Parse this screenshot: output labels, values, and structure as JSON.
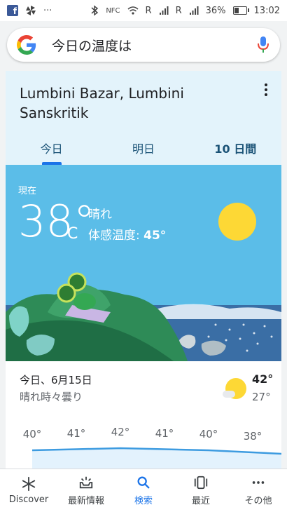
{
  "status_bar": {
    "icons_left": [
      "facebook-icon",
      "pinwheel-icon",
      "more-icon"
    ],
    "more_dots": "···",
    "icons_right": [
      "bluetooth-icon",
      "nfc-icon",
      "wifi-icon",
      "signal-icon",
      "signal-icon"
    ],
    "nfc": "NFC",
    "roaming1": "R",
    "roaming2": "R",
    "battery_pct": "36%",
    "battery_level": 0.36,
    "time": "13:02"
  },
  "search": {
    "query": "今日の温度は"
  },
  "weather": {
    "location": "Lumbini Bazar, Lumbini Sanskritik",
    "tabs": [
      {
        "label": "今日"
      },
      {
        "label": "明日"
      },
      {
        "label": "10 日間"
      }
    ],
    "now_label": "現在",
    "temperature": "38°",
    "unit": "C",
    "condition": "晴れ",
    "feels_like_label": "体感温度: ",
    "feels_like_value": "45°",
    "forecast": {
      "date": "今日、6月15日",
      "description": "晴れ時々曇り",
      "high": "42°",
      "low": "27°",
      "hourly": [
        "40°",
        "41°",
        "42°",
        "41°",
        "40°",
        "38°"
      ]
    }
  },
  "bottom_nav": [
    {
      "label": "Discover",
      "icon": "asterisk-icon"
    },
    {
      "label": "最新情報",
      "icon": "updates-icon"
    },
    {
      "label": "検索",
      "icon": "search-icon"
    },
    {
      "label": "最近",
      "icon": "recent-icon"
    },
    {
      "label": "その他",
      "icon": "more-icon"
    }
  ],
  "colors": {
    "accent": "#1a73e8",
    "sky": "#5bbde8",
    "sun": "#fdd835",
    "card_bg": "#e3f3fb"
  }
}
